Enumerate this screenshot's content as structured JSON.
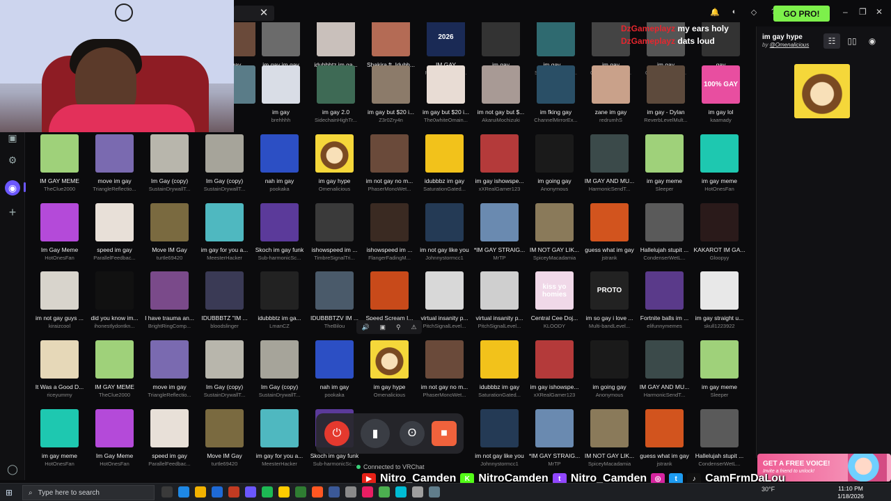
{
  "window": {
    "go_pro_label": "GO PRO!",
    "close_tab": "✕",
    "controls": [
      "–",
      "❐",
      "✕"
    ]
  },
  "sidebar": {
    "icons": [
      "clapper-icon",
      "settings-icon",
      "active-app-icon",
      "add-icon",
      "user-icon"
    ]
  },
  "chat": [
    {
      "user": "DzGameplayz",
      "message": "my ears holy"
    },
    {
      "user": "DzGameplayz",
      "message": "dats loud"
    }
  ],
  "grid": {
    "rows": [
      [
        {
          "title": "gay",
          "author": "",
          "color": "#6a4a3a"
        },
        {
          "title": "im gay im gay",
          "author": "ayyblueitronny",
          "color": "#6b6b6b"
        },
        {
          "title": "idubbbtz im ga...",
          "author": "Txxlsmael",
          "color": "#c9c0bb"
        },
        {
          "title": "Shakira ft. Idubb...",
          "author": "Fractalz",
          "color": "#b46b55"
        },
        {
          "title": "IM GAY",
          "author": "PitchReflectionP...",
          "color": "#1a2a55",
          "text": "2026"
        },
        {
          "title": "im gay",
          "author": "Jakeopulois",
          "color": "#333"
        },
        {
          "title": "im gay.....",
          "author": "SidechainHighTr...",
          "color": "#2f6a70"
        },
        {
          "title": "im gay",
          "author": "ConvolutionSter...",
          "color": "#444"
        },
        {
          "title": "im gay",
          "author": "ConvolutionSter...",
          "color": "#555"
        },
        {
          "title": "gay",
          "author": "FrankdaTank",
          "color": "#333"
        }
      ],
      [
        {
          "title": "",
          "author": "",
          "color": "#5a7c88"
        },
        {
          "title": "im gay",
          "author": "brehhhh",
          "color": "#d9dde6"
        },
        {
          "title": "im gay 2.0",
          "author": "SidechainHighTr...",
          "color": "#3e6a55"
        },
        {
          "title": "im gay but $20 i...",
          "author": "Z3r0Zry4n",
          "color": "#8c7b6a"
        },
        {
          "title": "im gay but $20 i...",
          "author": "The0whiteOmain...",
          "color": "#e8dcd4"
        },
        {
          "title": "im not gay but $...",
          "author": "AkaruiMochizuki",
          "color": "#a89a95"
        },
        {
          "title": "im fking gay",
          "author": "ChannelMirrorEx...",
          "color": "#2a4f66"
        },
        {
          "title": "zane im gay",
          "author": "redrumhS",
          "color": "#c9a18a"
        },
        {
          "title": "im gay - Dylan",
          "author": "ReverbLevelMult...",
          "color": "#5d4a3c"
        },
        {
          "title": "im gay lol",
          "author": "kaamady",
          "color": "#e84ea0",
          "text": "100% GAY"
        }
      ],
      [
        {
          "title": "IM GAY MEME",
          "author": "TheClue2000",
          "color": "#9fd17a"
        },
        {
          "title": "move im gay",
          "author": "TriangleReflectio...",
          "color": "#7a6ab0"
        },
        {
          "title": "Im Gay (copy)",
          "author": "SustainDrywallT...",
          "color": "#b8b6ac"
        },
        {
          "title": "Im Gay (copy)",
          "author": "SustainDrywallT...",
          "color": "#a6a49a"
        },
        {
          "title": "nah im gay",
          "author": "pookaka",
          "color": "#2c4fc4"
        },
        {
          "title": "im gay hype",
          "author": "Omenalicious",
          "color": "#f5d73a"
        },
        {
          "title": "im not gay no m...",
          "author": "PhaserMonoWet...",
          "color": "#6a4a3a"
        },
        {
          "title": "idubbbz im gay",
          "author": "SaturationGated...",
          "color": "#f2c21b"
        },
        {
          "title": "im gay ishowspe...",
          "author": "xXRealGamer123",
          "color": "#b43a3a"
        },
        {
          "title": "im going gay",
          "author": "Anonymous",
          "color": "#1a1a1a"
        },
        {
          "title": "IM GAY AND MU...",
          "author": "HarmonicSendT...",
          "color": "#3b4a4a"
        },
        {
          "title": "im gay meme",
          "author": "Sleeper",
          "color": "#9fd17a"
        },
        {
          "title": "im gay meme",
          "author": "HotOnesFan",
          "color": "#1ec8b0"
        }
      ],
      [
        {
          "title": "Im Gay Meme",
          "author": "HotOnesFan",
          "color": "#b44ad9"
        },
        {
          "title": "speed im gay",
          "author": "ParallelFeedbac...",
          "color": "#e8e0d8"
        },
        {
          "title": "Move IM Gay",
          "author": "turtle69420",
          "color": "#7a6a40"
        },
        {
          "title": "im gay for you a...",
          "author": "MeesterHacker",
          "color": "#4fb8c0"
        },
        {
          "title": "Skoch im gay funk",
          "author": "Sub-harmonicSc...",
          "color": "#5b3a9a"
        },
        {
          "title": "ishowspeed im ...",
          "author": "TimbreSignalTri...",
          "color": "#3a3a3a"
        },
        {
          "title": "ishowspeed im ...",
          "author": "FlangerFadingM...",
          "color": "#3a2a22"
        },
        {
          "title": "im not gay like you",
          "author": "Johnnystormcc1",
          "color": "#243a55"
        },
        {
          "title": "*IM GAY STRAIG...",
          "author": "MrTP",
          "color": "#6a8ab0"
        },
        {
          "title": "IM NOT GAY LIK...",
          "author": "SpiceyMacadamia",
          "color": "#8a7a5a"
        },
        {
          "title": "guess what im gay",
          "author": "jstrank",
          "color": "#d2541e"
        },
        {
          "title": "Hallelujah stupit ...",
          "author": "CondenserWetL...",
          "color": "#5a5a5a"
        },
        {
          "title": "KAKAROT IM GA...",
          "author": "Gloopyy",
          "color": "#2a1a1a"
        }
      ],
      [
        {
          "title": "im not gay guys ...",
          "author": "kiraizcool",
          "color": "#d8d4cc"
        },
        {
          "title": "did you know im...",
          "author": "ihonestlydontkn...",
          "color": "#111"
        },
        {
          "title": "I have trauma an...",
          "author": "BrightRingComp...",
          "color": "#7a4a8a"
        },
        {
          "title": "IDUBBBTZ \"IM ...",
          "author": "bloodslinger",
          "color": "#3a3a55"
        },
        {
          "title": "idubbbtz im ga...",
          "author": "LmanCZ",
          "color": "#222"
        },
        {
          "title": "IDUBBBTZV IM ...",
          "author": "TheBilou",
          "color": "#4a5a6a"
        },
        {
          "title": "Speed Scream I...",
          "author": "",
          "color": "#c84a1a"
        },
        {
          "title": "virtual insanity p...",
          "author": "PitchSignalLevel...",
          "color": "#d8d8d8"
        },
        {
          "title": "virtual insanity p...",
          "author": "PitchSignalLevel...",
          "color": "#cfcfcf"
        },
        {
          "title": "Central Cee Doj...",
          "author": "KLOODY",
          "color": "#f0d8e8",
          "text": "kiss yo homies"
        },
        {
          "title": "im so gay i love ...",
          "author": "Multi-bandLevel...",
          "color": "#222",
          "text": "PROTO"
        },
        {
          "title": "Fortnite balls im ...",
          "author": "elifunnymemes",
          "color": "#5a3a8a"
        },
        {
          "title": "im gay straight u...",
          "author": "skull1223922",
          "color": "#e8e8e8"
        }
      ],
      [
        {
          "title": "It Was a Good D...",
          "author": "riceyummy",
          "color": "#e6d8b8"
        },
        {
          "title": "IM GAY MEME",
          "author": "TheClue2000",
          "color": "#9fd17a"
        },
        {
          "title": "move im gay",
          "author": "TriangleReflectio...",
          "color": "#7a6ab0"
        },
        {
          "title": "Im Gay (copy)",
          "author": "SustainDrywallT...",
          "color": "#b8b6ac"
        },
        {
          "title": "Im Gay (copy)",
          "author": "SustainDrywallT...",
          "color": "#a6a49a"
        },
        {
          "title": "nah im gay",
          "author": "pookaka",
          "color": "#2c4fc4"
        },
        {
          "title": "im gay hype",
          "author": "Omenalicious",
          "color": "#f5d73a"
        },
        {
          "title": "im not gay no m...",
          "author": "PhaserMonoWet...",
          "color": "#6a4a3a"
        },
        {
          "title": "idubbbz im gay",
          "author": "SaturationGated...",
          "color": "#f2c21b"
        },
        {
          "title": "im gay ishowspe...",
          "author": "xXRealGamer123",
          "color": "#b43a3a"
        },
        {
          "title": "im going gay",
          "author": "Anonymous",
          "color": "#1a1a1a"
        },
        {
          "title": "IM GAY AND MU...",
          "author": "HarmonicSendT...",
          "color": "#3b4a4a"
        },
        {
          "title": "im gay meme",
          "author": "Sleeper",
          "color": "#9fd17a"
        }
      ],
      [
        {
          "title": "im gay meme",
          "author": "HotOnesFan",
          "color": "#1ec8b0"
        },
        {
          "title": "Im Gay Meme",
          "author": "HotOnesFan",
          "color": "#b44ad9"
        },
        {
          "title": "speed im gay",
          "author": "ParallelFeedbac...",
          "color": "#e8e0d8"
        },
        {
          "title": "Move IM Gay",
          "author": "turtle69420",
          "color": "#7a6a40"
        },
        {
          "title": "im gay for you a...",
          "author": "MeesterHacker",
          "color": "#4fb8c0"
        },
        {
          "title": "Skoch im gay funk",
          "author": "Sub-harmonicSc...",
          "color": "#5b3a9a"
        },
        {
          "title": "",
          "author": "",
          "color": "#0b0b0d"
        },
        {
          "title": "",
          "author": "",
          "color": "#0b0b0d"
        },
        {
          "title": "im not gay like you",
          "author": "Johnnystormcc1",
          "color": "#243a55"
        },
        {
          "title": "*IM GAY STRAIG...",
          "author": "MrTP",
          "color": "#6a8ab0"
        },
        {
          "title": "IM NOT GAY LIK...",
          "author": "SpiceyMacadamia",
          "color": "#8a7a5a"
        },
        {
          "title": "guess what im gay",
          "author": "jstrank",
          "color": "#d2541e"
        },
        {
          "title": "Hallelujah stupit ...",
          "author": "CondenserWetL...",
          "color": "#5a5a5a"
        }
      ]
    ]
  },
  "detail": {
    "title": "im gay hype",
    "by_prefix": "by ",
    "author": "@Omenalicious",
    "art_color": "#f5d73a"
  },
  "sound_controls": [
    "🔊",
    "▣",
    "⚲",
    "⚠"
  ],
  "dock": {
    "connection_status": "Connected to VRChat"
  },
  "promo": {
    "title": "GET A FREE VOICE!",
    "subtitle": "Invite a friend to unlock!"
  },
  "socials": [
    {
      "icon": "youtube-icon",
      "color": "#e62117",
      "glyph": "▶",
      "handle": "Nitro_Camden"
    },
    {
      "icon": "kick-icon",
      "color": "#53fc18",
      "glyph": "K",
      "handle": "NitroCamden"
    },
    {
      "icon": "twitch-icon",
      "color": "#9146ff",
      "glyph": "t",
      "handle": "Nitro_Camden"
    },
    {
      "icon": "instagram-icon",
      "color": "#d6249f",
      "glyph": "◎",
      "handle": ""
    },
    {
      "icon": "twitter-icon",
      "color": "#1d9bf0",
      "glyph": "t",
      "handle": ""
    },
    {
      "icon": "tiktok-icon",
      "color": "#111111",
      "glyph": "♪",
      "handle": "CamFrmDaLou"
    }
  ],
  "taskbar": {
    "search_placeholder": "Type here to search",
    "weather": "30°F",
    "time": "11:10 PM",
    "date": "1/18/2026",
    "app_colors": [
      "#3a3a3a",
      "#1e88e5",
      "#f2b200",
      "#1e6ad6",
      "#c23b22",
      "#6b57ff",
      "#1db954",
      "#ffcc00",
      "#2f7d32",
      "#ff5722",
      "#3b5998",
      "#8a8a8a",
      "#e91e63",
      "#4caf50",
      "#00bcd4",
      "#9e9e9e",
      "#607d8b"
    ]
  }
}
